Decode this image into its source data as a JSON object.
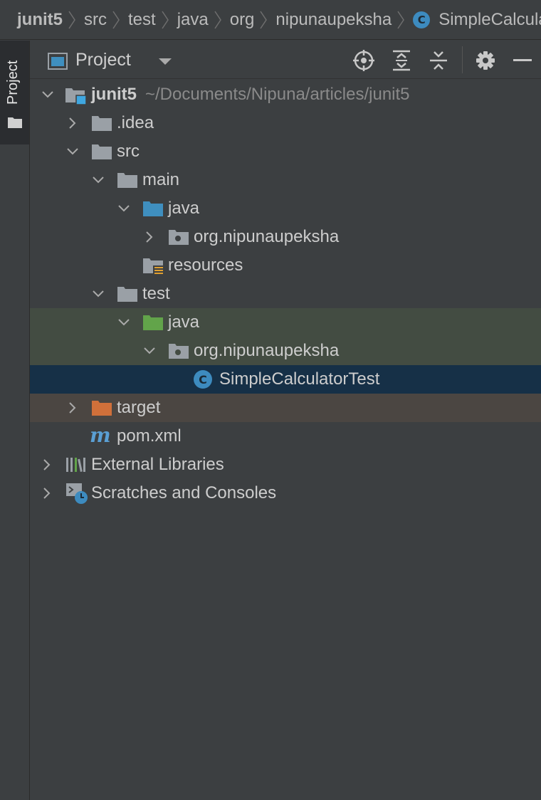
{
  "breadcrumb": [
    "junit5",
    "src",
    "test",
    "java",
    "org",
    "nipunaupeksha",
    "SimpleCalculatorTest"
  ],
  "class_icon_letter": "C",
  "toolstrip": {
    "tab_label": "Project"
  },
  "project_header": {
    "title": "Project"
  },
  "tree": {
    "root": {
      "name": "junit5",
      "path": "~/Documents/Nipuna/articles/junit5"
    },
    "idea": ".idea",
    "src": "src",
    "main": "main",
    "main_java": "java",
    "main_pkg": "org.nipunaupeksha",
    "resources": "resources",
    "test": "test",
    "test_java": "java",
    "test_pkg": "org.nipunaupeksha",
    "test_class": "SimpleCalculatorTest",
    "target": "target",
    "pom": "pom.xml",
    "external_libraries": "External Libraries",
    "scratches": "Scratches and Consoles"
  },
  "colors": {
    "background": "#3c3f41",
    "folder": "#9aa0a6",
    "source_folder": "#3f8fbf",
    "test_folder": "#62a44a",
    "excluded_folder": "#d0703a",
    "selected_row": "#163047",
    "test_row": "#434c42",
    "excluded_row": "#4b4642"
  }
}
